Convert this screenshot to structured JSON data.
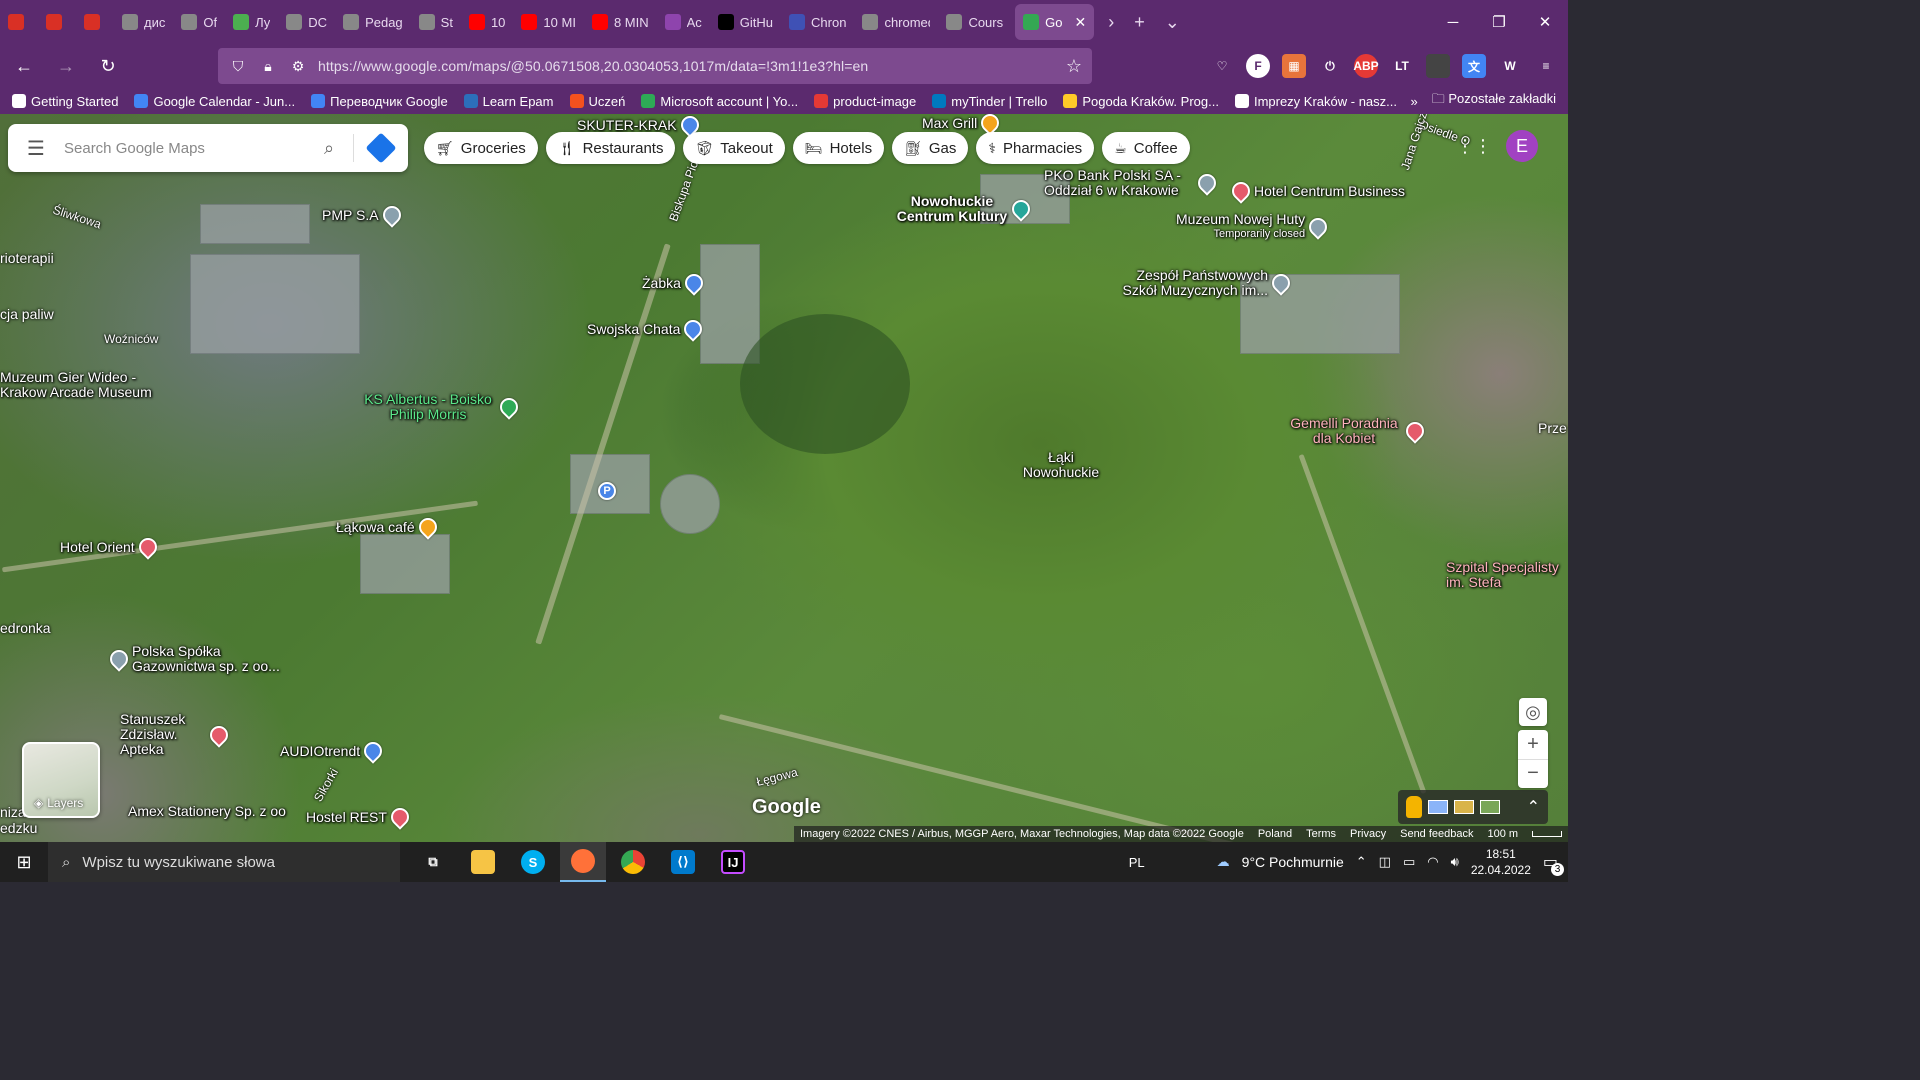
{
  "browser": {
    "tabs": [
      {
        "label": "",
        "icon": "gmail-icon",
        "color": "#d93025"
      },
      {
        "label": "",
        "icon": "gmail-icon",
        "color": "#d93025"
      },
      {
        "label": "",
        "icon": "gmail-icon",
        "color": "#d93025"
      },
      {
        "label": "дис",
        "icon": "tab-icon",
        "color": "#888888"
      },
      {
        "label": "Of",
        "icon": "tab-icon",
        "color": "#888888"
      },
      {
        "label": "Лу",
        "icon": "tab-icon",
        "color": "#4caf50"
      },
      {
        "label": "DC",
        "icon": "tab-icon",
        "color": "#888888"
      },
      {
        "label": "Pedag",
        "icon": "tab-icon",
        "color": "#888888"
      },
      {
        "label": "St",
        "icon": "tab-icon",
        "color": "#888888"
      },
      {
        "label": "10",
        "icon": "youtube-icon",
        "color": "#ff0000"
      },
      {
        "label": "10 MI",
        "icon": "youtube-icon",
        "color": "#ff0000"
      },
      {
        "label": "8 MIN",
        "icon": "youtube-icon",
        "color": "#ff0000"
      },
      {
        "label": "Ac",
        "icon": "tab-icon",
        "color": "#8e44ad"
      },
      {
        "label": "GitHu",
        "icon": "github-icon",
        "color": "#000000"
      },
      {
        "label": "Chron",
        "icon": "tab-icon",
        "color": "#3f51b5"
      },
      {
        "label": "chromedri",
        "icon": "tab-icon",
        "color": "#888888"
      },
      {
        "label": "Cours",
        "icon": "tab-icon",
        "color": "#888888"
      },
      {
        "label": "Go",
        "icon": "google-maps-icon",
        "color": "#34a853"
      }
    ],
    "url": "https://www.google.com/maps/@50.0671508,20.0304053,1017m/data=!3m1!1e3?hl=en",
    "bookmarks": [
      {
        "label": "Getting Started",
        "color": "#ffffff"
      },
      {
        "label": "Google Calendar - Jun...",
        "color": "#4285f4"
      },
      {
        "label": "Переводчик Google",
        "color": "#4285f4"
      },
      {
        "label": "Learn Epam",
        "color": "#2c6fbb"
      },
      {
        "label": "Uczeń",
        "color": "#f4511e"
      },
      {
        "label": "Microsoft account | Yo...",
        "color": "#2eaa56"
      },
      {
        "label": "product-image",
        "color": "#e53935"
      },
      {
        "label": "myTinder | Trello",
        "color": "#0079bf"
      },
      {
        "label": "Pogoda Kraków. Prog...",
        "color": "#ffca28"
      },
      {
        "label": "Imprezy Kraków - nasz...",
        "color": "#ffffff"
      }
    ],
    "other_bookmarks": "Pozostałe zakładki"
  },
  "maps": {
    "search_placeholder": "Search Google Maps",
    "chips": [
      {
        "label": "Groceries",
        "icon": "cart-icon"
      },
      {
        "label": "Restaurants",
        "icon": "fork-knife-icon"
      },
      {
        "label": "Takeout",
        "icon": "takeout-icon"
      },
      {
        "label": "Hotels",
        "icon": "bed-icon"
      },
      {
        "label": "Gas",
        "icon": "gas-icon"
      },
      {
        "label": "Pharmacies",
        "icon": "pharmacy-icon"
      },
      {
        "label": "Coffee",
        "icon": "coffee-icon"
      }
    ],
    "avatar_letter": "E",
    "layers_label": "Layers",
    "logo": "Google",
    "attribution": {
      "imagery": "Imagery ©2022 CNES / Airbus, MGGP Aero, Maxar Technologies, Map data ©2022 Google",
      "country": "Poland",
      "terms": "Terms",
      "privacy": "Privacy",
      "feedback": "Send feedback",
      "scale": "100 m"
    },
    "places": [
      {
        "label": "SKUTER-KRAK",
        "pin": "blue"
      },
      {
        "label": "Max Grill",
        "pin": "orange"
      },
      {
        "label": "PMP S.A",
        "pin": "gray"
      },
      {
        "label": "Nowohuckie Centrum Kultury",
        "pin": "teal"
      },
      {
        "label": "PKO Bank Polski SA - Oddział 6 w Krakowie",
        "pin": "gray"
      },
      {
        "label": "Hotel Centrum Business",
        "pin": "red"
      },
      {
        "label": "Muzeum Nowej Huty",
        "sub": "Temporarily closed",
        "pin": "gray"
      },
      {
        "label": "Żabka",
        "pin": "blue"
      },
      {
        "label": "Swojska Chata",
        "pin": "blue"
      },
      {
        "label": "Zespół Państwowych Szkół Muzycznych im...",
        "pin": "gray"
      },
      {
        "label": "Muzeum Gier Wideo - Krakow Arcade Museum",
        "pin": "gray"
      },
      {
        "label": "KS Albertus - Boisko Philip Morris",
        "pin": "green"
      },
      {
        "label": "Łąki Nowohuckie",
        "pin": ""
      },
      {
        "label": "Gemelli Poradnia dla Kobiet",
        "pin": "red"
      },
      {
        "label": "Łąkowa café",
        "pin": "orange"
      },
      {
        "label": "Hotel Orient",
        "pin": "red"
      },
      {
        "label": "Szpital Specjalisty im. Stefa",
        "pin": "red"
      },
      {
        "label": "Polska Spółka Gazownictwa sp. z oo...",
        "pin": "gray"
      },
      {
        "label": "Stanuszek Zdzisław. Apteka",
        "pin": "red"
      },
      {
        "label": "AUDIOtrendt",
        "pin": "blue"
      },
      {
        "label": "Amex Stationery Sp. z oo",
        "pin": "gray"
      },
      {
        "label": "Hostel REST",
        "pin": "red"
      }
    ],
    "streets": [
      "Śliwkowa",
      "Woźniców",
      "Biskupa Pio",
      "Sikorki",
      "Łęgowa",
      "Osiedle O",
      "Jana Gajcz",
      "Prze",
      "edronka",
      "rioterapii",
      "cja paliw",
      "edzku",
      "niza"
    ]
  },
  "taskbar": {
    "search_placeholder": "Wpisz tu wyszukiwane słowa",
    "lang": "PL",
    "weather": "9°C  Pochmurnie",
    "time": "18:51",
    "date": "22.04.2022",
    "notif_count": "3"
  }
}
